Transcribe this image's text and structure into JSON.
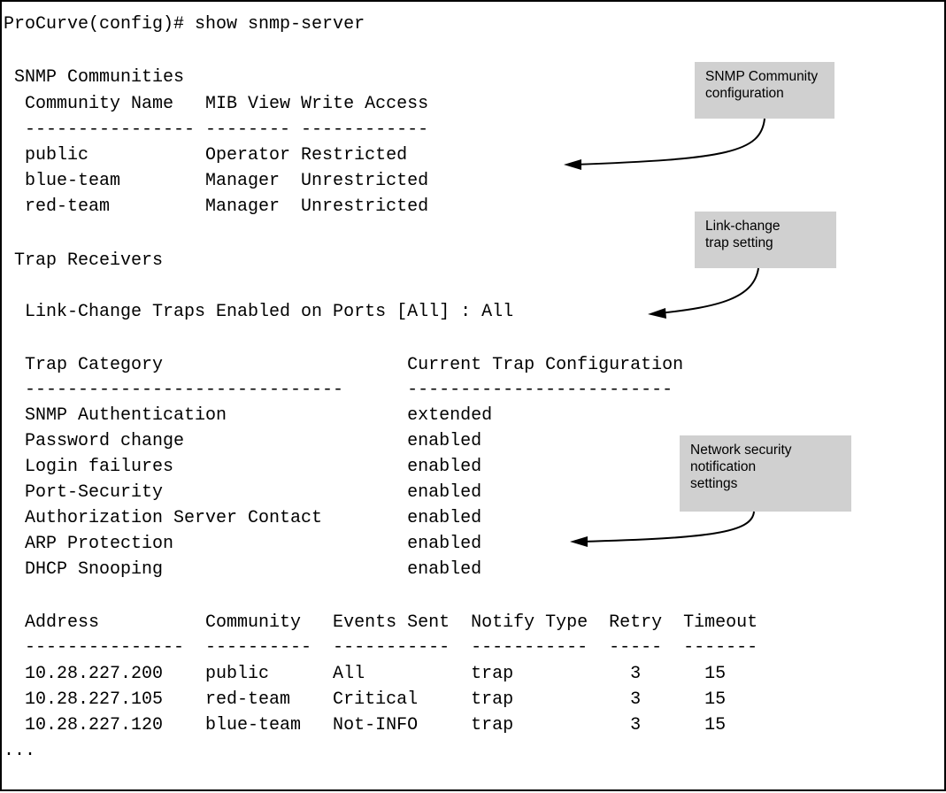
{
  "lines": {
    "prompt": "ProCurve(config)# show snmp-server",
    "snmp_communities": " SNMP Communities",
    "community_header": "  Community Name   MIB View Write Access",
    "community_rule": "  ---------------- -------- ------------",
    "community_row1": "  public           Operator Restricted",
    "community_row2": "  blue-team        Manager  Unrestricted",
    "community_row3": "  red-team         Manager  Unrestricted",
    "trap_receivers": " Trap Receivers",
    "link_change": "  Link-Change Traps Enabled on Ports [All] : All",
    "trap_header": "  Trap Category                       Current Trap Configuration",
    "trap_rule": "  ------------------------------      -------------------------",
    "trap_row1": "  SNMP Authentication                 extended",
    "trap_row2": "  Password change                     enabled",
    "trap_row3": "  Login failures                      enabled",
    "trap_row4": "  Port-Security                       enabled",
    "trap_row5": "  Authorization Server Contact        enabled",
    "trap_row6": "  ARP Protection                      enabled",
    "trap_row7": "  DHCP Snooping                       enabled",
    "addr_header": "  Address          Community   Events Sent  Notify Type  Retry  Timeout",
    "addr_rule": "  ---------------  ----------  -----------  -----------  -----  -------",
    "addr_row1": "  10.28.227.200    public      All          trap           3      15",
    "addr_row2": "  10.28.227.105    red-team    Critical     trap           3      15",
    "addr_row3": "  10.28.227.120    blue-team   Not-INFO     trap           3      15",
    "ellipsis": "..."
  },
  "callouts": {
    "community": "SNMP Community\nconfiguration",
    "link_change": "Link-change\ntrap setting",
    "security": "Network security\nnotification\nsettings"
  },
  "colors": {
    "callout_fill": "#d0d0d0",
    "text": "#000000",
    "border": "#000000"
  }
}
